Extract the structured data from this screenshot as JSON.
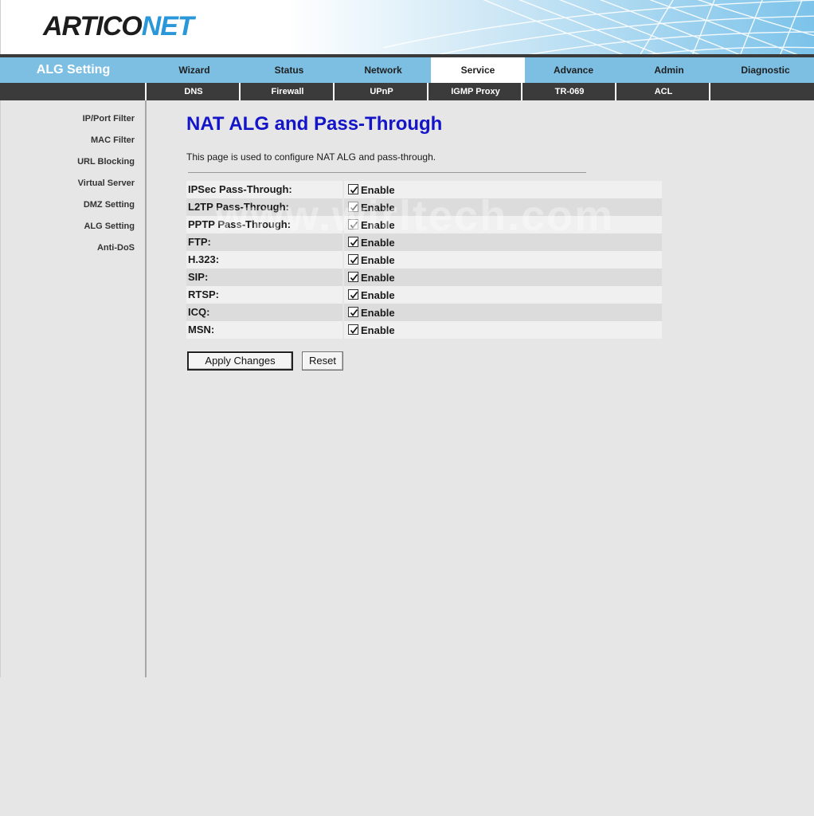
{
  "brand": {
    "logo_main": "ARTICO",
    "logo_accent": "NET"
  },
  "section_title": "ALG Setting",
  "main_tabs": [
    {
      "label": "Wizard",
      "active": false
    },
    {
      "label": "Status",
      "active": false
    },
    {
      "label": "Network",
      "active": false
    },
    {
      "label": "Service",
      "active": true
    },
    {
      "label": "Advance",
      "active": false
    },
    {
      "label": "Admin",
      "active": false
    },
    {
      "label": "Diagnostic",
      "active": false
    }
  ],
  "sub_tabs": [
    "DNS",
    "Firewall",
    "UPnP",
    "IGMP Proxy",
    "TR-069",
    "ACL",
    ""
  ],
  "sidebar": {
    "items": [
      "IP/Port Filter",
      "MAC Filter",
      "URL Blocking",
      "Virtual Server",
      "DMZ Setting",
      "ALG Setting",
      "Anti-DoS"
    ]
  },
  "page": {
    "title": "NAT ALG and Pass-Through",
    "description": "This page is used to configure NAT ALG and pass-through."
  },
  "alg_rows": [
    {
      "label": "IPSec Pass-Through:",
      "option": "Enable",
      "checked": true
    },
    {
      "label": "L2TP Pass-Through:",
      "option": "Enable",
      "checked": true
    },
    {
      "label": "PPTP Pass-Through:",
      "option": "Enable",
      "checked": true
    },
    {
      "label": "FTP:",
      "option": "Enable",
      "checked": true
    },
    {
      "label": "H.323:",
      "option": "Enable",
      "checked": true
    },
    {
      "label": "SIP:",
      "option": "Enable",
      "checked": true
    },
    {
      "label": "RTSP:",
      "option": "Enable",
      "checked": true
    },
    {
      "label": "ICQ:",
      "option": "Enable",
      "checked": true
    },
    {
      "label": "MSN:",
      "option": "Enable",
      "checked": true
    }
  ],
  "buttons": {
    "apply": "Apply Changes",
    "reset": "Reset"
  },
  "watermark": "www.wirltech.com",
  "colors": {
    "nav_blue": "#7cbfe3",
    "title_blue": "#1414c8",
    "logo_accent": "#2a97d8",
    "subnav_dark": "#3b3b3b"
  }
}
